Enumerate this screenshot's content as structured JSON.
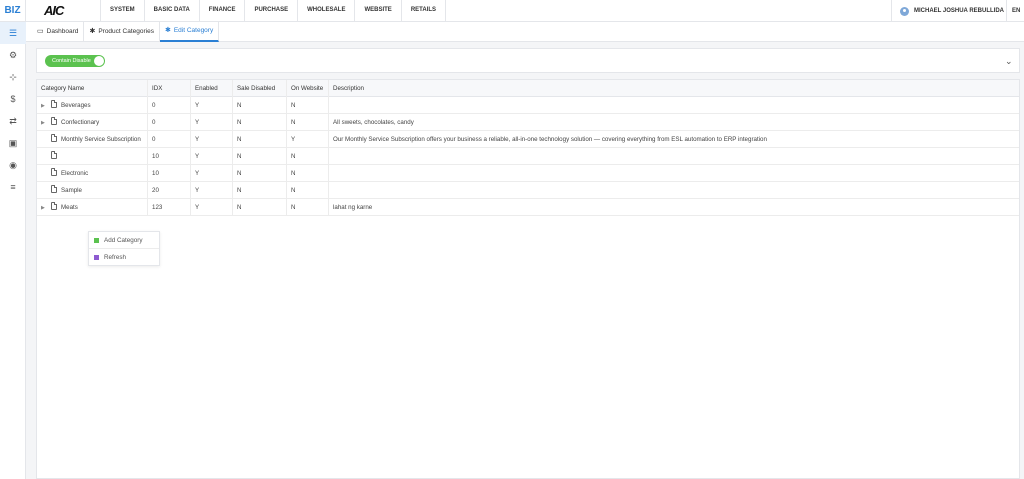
{
  "app": {
    "brand": "BIZ",
    "logo_text": "AIC",
    "logo_subtext": "..."
  },
  "top_menu": [
    "SYSTEM",
    "BASIC DATA",
    "FINANCE",
    "PURCHASE",
    "WHOLESALE",
    "WEBSITE",
    "RETAILS"
  ],
  "user": {
    "name": "MICHAEL JOSHUA REBULLIDA",
    "lang": "EN"
  },
  "sidebar": {
    "items": [
      {
        "icon": "list-icon",
        "glyph": "☰",
        "active": true
      },
      {
        "icon": "gear-icon",
        "glyph": "⚙",
        "active": false
      },
      {
        "icon": "org-chart-icon",
        "glyph": "⊹",
        "active": false
      },
      {
        "icon": "dollar-icon",
        "glyph": "$",
        "active": false
      },
      {
        "icon": "exchange-icon",
        "glyph": "⇄",
        "active": false
      },
      {
        "icon": "cash-icon",
        "glyph": "▣",
        "active": false
      },
      {
        "icon": "globe-icon",
        "glyph": "◉",
        "active": false
      },
      {
        "icon": "menu-icon",
        "glyph": "≡",
        "active": false
      }
    ]
  },
  "tabs": [
    {
      "label": "Dashboard",
      "icon": "monitor-icon",
      "glyph": "▭",
      "active": false
    },
    {
      "label": "Product Categories",
      "icon": "asterisk-icon",
      "glyph": "✱",
      "active": false
    },
    {
      "label": "Edit Category",
      "icon": "asterisk-icon",
      "glyph": "✱",
      "active": true
    }
  ],
  "filter": {
    "toggle_label": "Contain Disable",
    "toggle_on": true,
    "chevron": "⌄"
  },
  "grid": {
    "columns": [
      "Category Name",
      "IDX",
      "Enabled",
      "Sale Disabled",
      "On Website",
      "Description"
    ],
    "rows": [
      {
        "name": "Beverages",
        "expandable": true,
        "idx": "0",
        "enabled": "Y",
        "sale_disabled": "N",
        "on_website": "N",
        "description": ""
      },
      {
        "name": "Confectionary",
        "expandable": true,
        "idx": "0",
        "enabled": "Y",
        "sale_disabled": "N",
        "on_website": "N",
        "description": "All sweets, chocolates, candy"
      },
      {
        "name": "Monthly Service Subscription",
        "expandable": false,
        "idx": "0",
        "enabled": "Y",
        "sale_disabled": "N",
        "on_website": "Y",
        "description": "Our Monthly Service Subscription offers your business a reliable, all-in-one technology solution — covering everything from ESL automation to ERP integration"
      },
      {
        "name": "",
        "expandable": false,
        "idx": "10",
        "enabled": "Y",
        "sale_disabled": "N",
        "on_website": "N",
        "description": ""
      },
      {
        "name": "Electronic",
        "expandable": false,
        "idx": "10",
        "enabled": "Y",
        "sale_disabled": "N",
        "on_website": "N",
        "description": ""
      },
      {
        "name": "Sample",
        "expandable": false,
        "idx": "20",
        "enabled": "Y",
        "sale_disabled": "N",
        "on_website": "N",
        "description": ""
      },
      {
        "name": "Meats",
        "expandable": true,
        "idx": "123",
        "enabled": "Y",
        "sale_disabled": "N",
        "on_website": "N",
        "description": "lahat ng karne"
      }
    ]
  },
  "context_menu": [
    {
      "label": "Add Category",
      "color": "#5bc24f"
    },
    {
      "label": "Refresh",
      "color": "#8e5bd1"
    }
  ],
  "colors": {
    "accent": "#2a7fd4",
    "toggle": "#5bc24f"
  }
}
